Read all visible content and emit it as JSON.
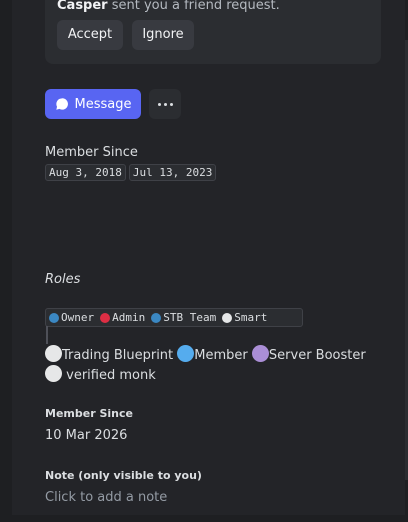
{
  "friend_request": {
    "name": "Casper",
    "text": " sent you a friend request.",
    "accept_label": "Accept",
    "ignore_label": "Ignore"
  },
  "actions": {
    "message_label": "Message",
    "message_icon": "chat-bubble-icon",
    "more_icon": "more-dots-icon"
  },
  "member_since": {
    "label": "Member Since",
    "discord_date": "Aug 3, 2018",
    "server_date": "Jul 13, 2023"
  },
  "bio": {
    "roles_heading": "Roles",
    "code_roles": [
      {
        "label": "Owner",
        "color": "#3b88c3"
      },
      {
        "label": "Admin",
        "color": "#dd2e44"
      },
      {
        "label": "STB Team",
        "color": "#3b88c3"
      },
      {
        "label": "Smart",
        "color": "#e6e7e8"
      }
    ],
    "text_roles": [
      {
        "label": "Trading Blueprint",
        "color": "#e6e7e8"
      },
      {
        "label": "Member",
        "color": "#55acee"
      },
      {
        "label": "Server Booster",
        "color": "#aa8ed6"
      },
      {
        "label": "verified monk",
        "color": "#e6e7e8"
      }
    ]
  },
  "server_member_since": {
    "label": "Member Since",
    "date": "10 Mar 2026"
  },
  "note": {
    "label": "Note (only visible to you)",
    "placeholder": "Click to add a note"
  },
  "colors": {
    "accent": "#5865f2",
    "background": "#232428",
    "card": "#2b2d31"
  }
}
